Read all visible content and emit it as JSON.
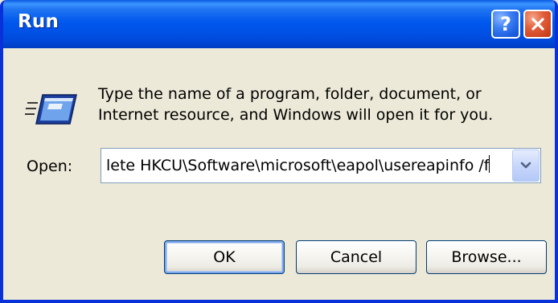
{
  "window": {
    "title": "Run",
    "help_label": "?",
    "colors": {
      "titlebar": "#0058ee",
      "frame": "#0831d9",
      "body": "#ece9d8",
      "close": "#d04622",
      "help": "#3c7ff3"
    }
  },
  "dialog": {
    "icon": "run-icon",
    "message_line1": "Type the name of a program, folder, document, or",
    "message_line2": "Internet resource, and Windows will open it for you.",
    "open_label": "Open:",
    "open_value": "lete HKCU\\Software\\microsoft\\eapol\\usereapinfo /f",
    "dropdown_icon": "chevron-down-icon"
  },
  "buttons": {
    "ok": "OK",
    "cancel": "Cancel",
    "browse": "Browse..."
  }
}
